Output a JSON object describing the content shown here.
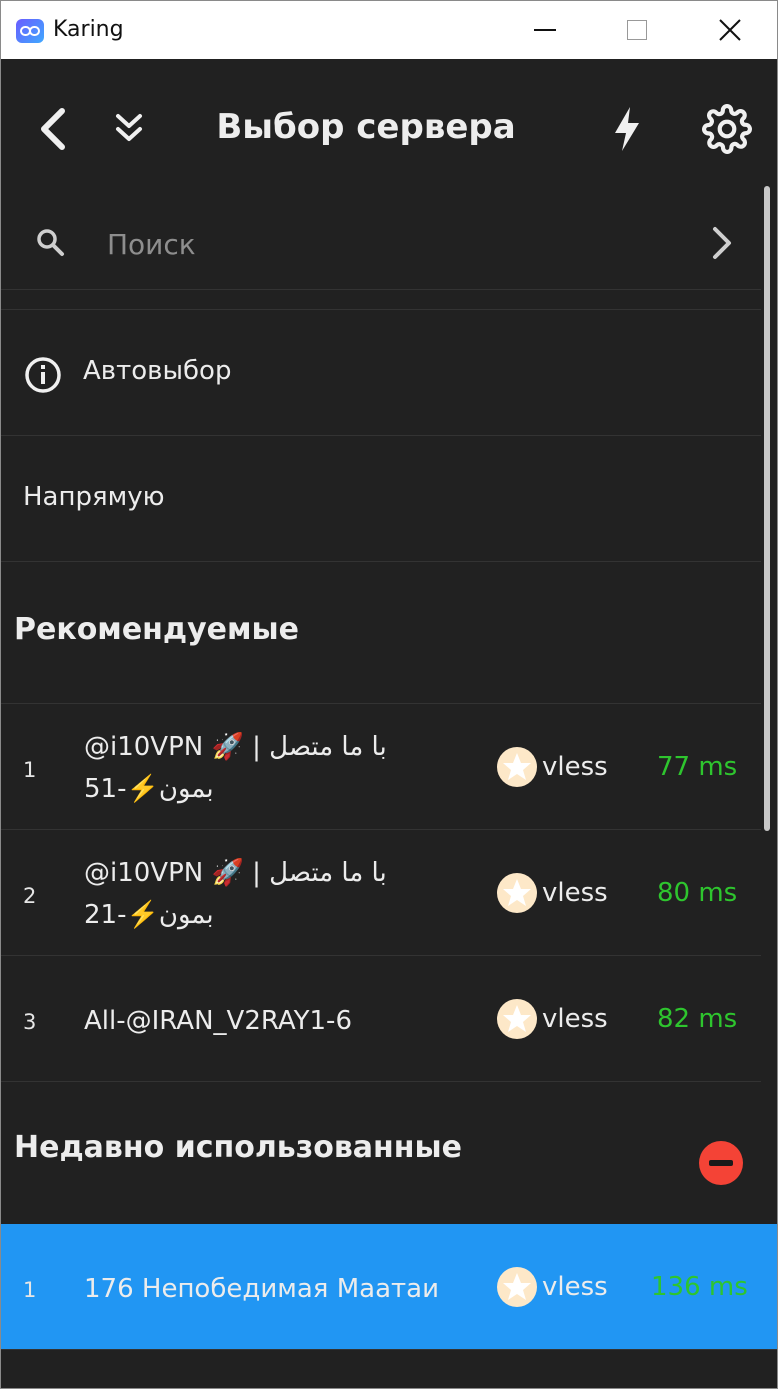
{
  "window": {
    "app_title": "Karing",
    "minimize_icon": "minimize-icon",
    "maximize_icon": "maximize-icon",
    "close_icon": "close-icon"
  },
  "appbar": {
    "title": "Выбор сервера",
    "back_icon": "chevron-left-icon",
    "collapse_icon": "double-chevron-down-icon",
    "speedtest_icon": "lightning-icon",
    "settings_icon": "gear-icon"
  },
  "search": {
    "placeholder": "Поиск",
    "value": ""
  },
  "items": {
    "auto_label": "Автовыбор",
    "direct_label": "Напрямую"
  },
  "sections": {
    "recommended": "Рекомендуемые",
    "recent": "Недавно использованные"
  },
  "recommended": [
    {
      "index": "1",
      "name_line1": "@i10VPN 🚀 | با ما متصل",
      "name_line2": "بمون⚡️-51",
      "protocol": "vless",
      "latency": "77 ms"
    },
    {
      "index": "2",
      "name_line1": "@i10VPN 🚀 | با ما متصل",
      "name_line2": "بمون⚡️-21",
      "protocol": "vless",
      "latency": "80 ms"
    },
    {
      "index": "3",
      "name_line1": "All-@IRAN_V2RAY1-6",
      "name_line2": "",
      "protocol": "vless",
      "latency": "82 ms"
    }
  ],
  "recent": [
    {
      "index": "1",
      "name_line1": "176 Непобедимая Маатаи",
      "protocol": "vless",
      "latency": "136 ms",
      "selected": true
    }
  ],
  "colors": {
    "background": "#212121",
    "latency_good": "#2ec52e",
    "selected_row": "#2196f3",
    "remove_button": "#f44336",
    "protocol_icon": "#fde8c8"
  }
}
